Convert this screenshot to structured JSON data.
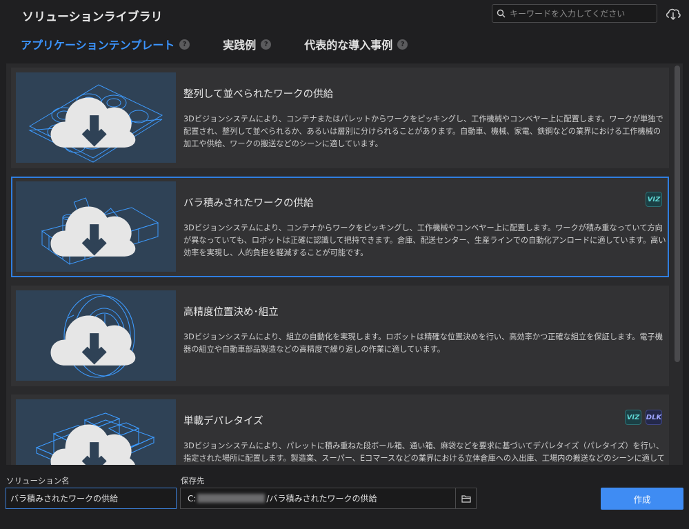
{
  "header": {
    "title": "ソリューションライブラリ",
    "search_placeholder": "キーワードを入力してください"
  },
  "tabs": [
    {
      "label": "アプリケーションテンプレート",
      "active": true
    },
    {
      "label": "実践例",
      "active": false
    },
    {
      "label": "代表的な導入事例",
      "active": false
    }
  ],
  "help_glyph": "?",
  "cards": [
    {
      "title": "整列して並べられたワークの供給",
      "desc": "3Dビジョンシステムにより、コンテナまたはパレットからワークをピッキングし、工作機械やコンベヤー上に配置します。ワークが単独で配置され、整列して並べられるか、あるいは層別に分けられることがあります。自動車、機械、家電、鉄鋼などの業界における工作機械の加工や供給、ワークの搬送などのシーンに適しています。",
      "badges": []
    },
    {
      "title": "バラ積みされたワークの供給",
      "desc": "3Dビジョンシステムにより、コンテナからワークをピッキングし、工作機械やコンベヤー上に配置します。ワークが積み重なっていて方向が異なっていても、ロボットは正確に認識して把持できます。倉庫、配送センター、生産ラインでの自動化アンロードに適しています。高い効率を実現し、人的負担を軽減することが可能です。",
      "badges": [
        "VIZ"
      ]
    },
    {
      "title": "高精度位置決め･組立",
      "desc": "3Dビジョンシステムにより、組立の自動化を実現します。ロボットは精確な位置決めを行い、高効率かつ正確な組立を保証します。電子機器の組立や自動車部品製造などの高精度で繰り返しの作業に適しています。",
      "badges": []
    },
    {
      "title": "単載デパレタイズ",
      "desc": "3Dビジョンシステムにより、パレットに積み重ねた段ボール箱、通い箱、麻袋などを要求に基づいてデパレタイズ（パレタイズ）を行い、指定された場所に配置します。製造業、スーパー、Eコマースなどの業界における立体倉庫への入出庫、工場内の搬送などのシーンに適して",
      "badges": [
        "VIZ",
        "DLK"
      ]
    }
  ],
  "footer": {
    "name_label": "ソリューション名",
    "name_value": "バラ積みされたワークの供給",
    "path_label": "保存先",
    "path_prefix": "C:",
    "path_suffix": "/バラ積みされたワークの供給",
    "create_label": "作成"
  },
  "colors": {
    "accent": "#3b94ff",
    "selected_border": "#2f7ee0",
    "create_button": "#3f8cf3",
    "thumb_bg": "#2f4256",
    "line_art": "#3d9bff"
  }
}
